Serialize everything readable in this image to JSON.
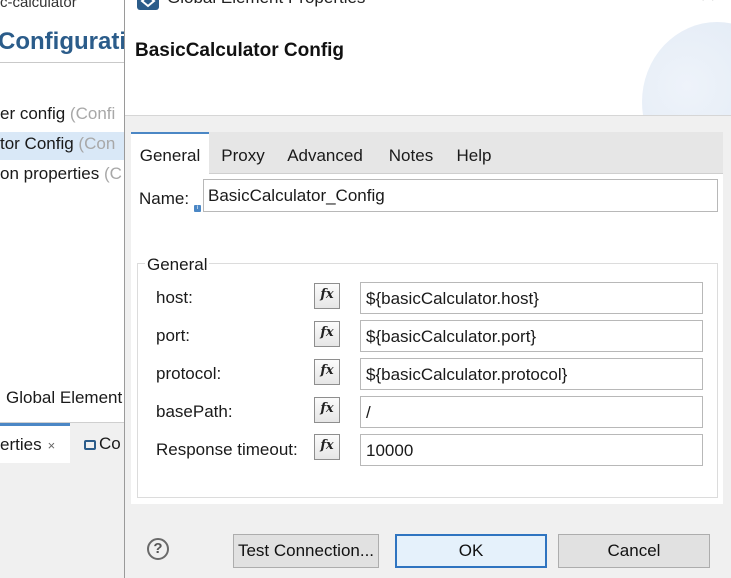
{
  "background": {
    "top_text": "c-calculator",
    "config_title": "Configuratio",
    "items": [
      {
        "label": "er config",
        "muted": " (Confi"
      },
      {
        "label": "tor Config",
        "muted": " (Con"
      },
      {
        "label": "on properties",
        "muted": " (C"
      }
    ],
    "global_elements_label": "Global Element",
    "tabs": {
      "properties": "erties",
      "close": "×",
      "console": "Co"
    }
  },
  "dialog": {
    "window_title": "Global Element Properties",
    "close_glyph": "✕",
    "header_title": "BasicCalculator Config",
    "tabs": [
      "General",
      "Proxy",
      "Advanced",
      "Notes",
      "Help"
    ],
    "active_tab": "General",
    "name_label": "Name:",
    "name_value": "BasicCalculator_Config",
    "group_label": "General",
    "fx_glyph": "fx",
    "fields": [
      {
        "label": "host:",
        "value": "${basicCalculator.host}"
      },
      {
        "label": "port:",
        "value": "${basicCalculator.port}"
      },
      {
        "label": "protocol:",
        "value": "${basicCalculator.protocol}"
      },
      {
        "label": "basePath:",
        "value": "/"
      },
      {
        "label": "Response timeout:",
        "value": "10000"
      }
    ],
    "buttons": {
      "help": "?",
      "test_connection": "Test Connection...",
      "ok": "OK",
      "cancel": "Cancel"
    }
  },
  "colors": {
    "accent": "#4b87c5",
    "ok_border": "#2f74c0",
    "config_title": "#2b5c8a"
  }
}
